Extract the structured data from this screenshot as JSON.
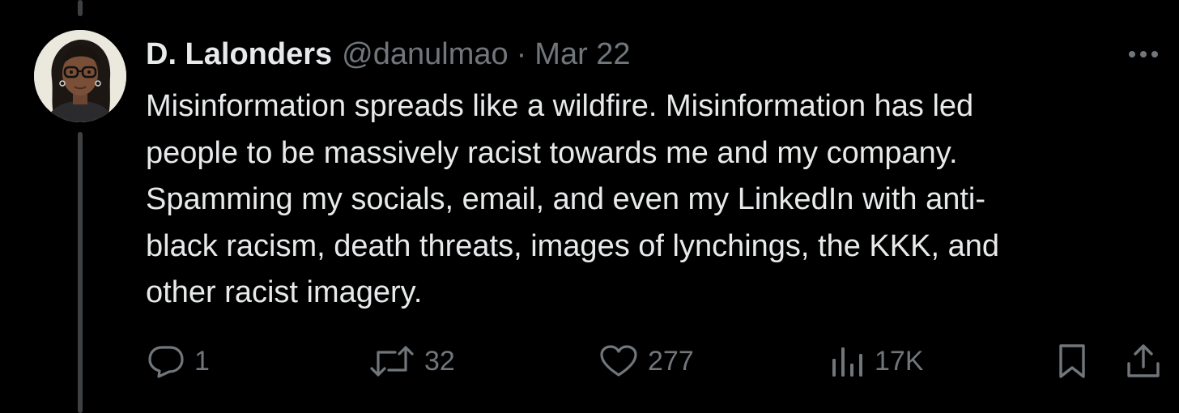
{
  "tweet": {
    "display_name": "D. Lalonders",
    "handle": "@danulmao",
    "separator": "·",
    "date": "Mar 22",
    "body_lines": [
      "Misinformation spreads like a wildfire. Misinformation has led",
      "people to be massively racist towards me and my company.",
      "Spamming my socials, email, and even my LinkedIn with anti-",
      "black racism, death threats, images of lynchings, the KKK, and",
      "other racist imagery."
    ]
  },
  "actions": {
    "reply_count": "1",
    "repost_count": "32",
    "like_count": "277",
    "views_count": "17K"
  },
  "icons": {
    "more": "more-horizontal-icon",
    "reply": "reply-icon",
    "repost": "repost-icon",
    "like": "heart-icon",
    "views": "views-chart-icon",
    "bookmark": "bookmark-icon",
    "share": "share-icon"
  },
  "colors": {
    "background": "#000000",
    "text_primary": "#e7e9ea",
    "text_secondary": "#71767b",
    "thread_line": "#3e4144"
  }
}
